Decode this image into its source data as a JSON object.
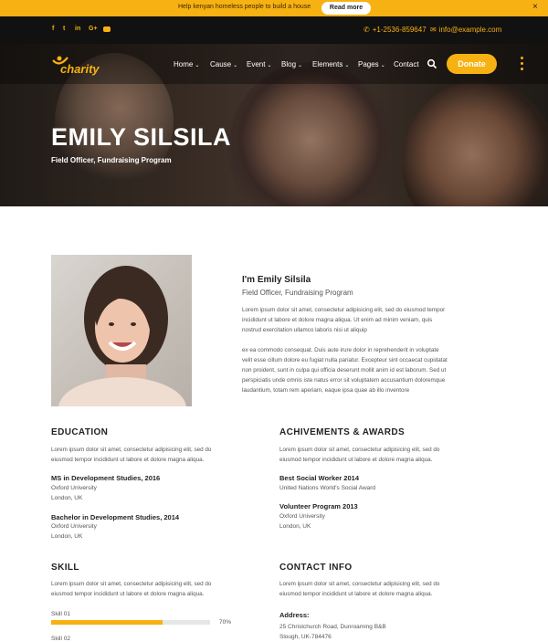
{
  "announcement": {
    "text": "Help kenyan homeless people to build a house",
    "button": "Read more",
    "close": "×"
  },
  "social": [
    "f",
    "t",
    "in",
    "G+",
    "yt"
  ],
  "contact": {
    "phone": "+1-2536-859647",
    "email": "info@example.com"
  },
  "brand": {
    "name": "charity"
  },
  "nav": {
    "items": [
      {
        "label": "Home",
        "dropdown": true
      },
      {
        "label": "Cause",
        "dropdown": true
      },
      {
        "label": "Event",
        "dropdown": true
      },
      {
        "label": "Blog",
        "dropdown": true
      },
      {
        "label": "Elements",
        "dropdown": true
      },
      {
        "label": "Pages",
        "dropdown": true
      },
      {
        "label": "Contact",
        "dropdown": false
      }
    ],
    "donate": "Donate"
  },
  "hero": {
    "title": "EMILY SILSILA",
    "subtitle": "Field Officer, Fundraising Program"
  },
  "profile": {
    "heading": "I'm Emily Silsila",
    "role": "Field Officer, Fundraising Program",
    "para1": [
      "Lorem ipsum dolor sit amet, consectetur adipisicing elit, sed do eiusmod tempor",
      "incididunt ut labore et dolore magna aliqua. Ut enim ad minim veniam, quis",
      "nostrud exercitation ullamco laboris nisi ut aliquip"
    ],
    "para2": [
      "ex ea commodo consequat. Duis aute irure dolor in reprehenderit in voluptate",
      "velit esse cillum dolore eu fugiat nulla pariatur. Excepteur sint occaecat cupidatat",
      "non proident, sunt in culpa qui officia deserunt mollit anim id est laborum. Sed ut",
      "perspiciatis unde omnis iste natus error sit voluptatem accusantium doloremque",
      "laudantium, totam rem aperiam, eaque ipsa quae ab illo inventore"
    ]
  },
  "education": {
    "title": "EDUCATION",
    "intro": [
      "Lorem ipsum dolor sit amet, consectetur adipisicing elit, sed do",
      "eiusmod tempor incididunt ut labore et dolore magna aliqua."
    ],
    "items": [
      {
        "title": "MS in Development Studies, 2016",
        "lines": [
          "Oxford University",
          "London, UK"
        ]
      },
      {
        "title": "Bachelor in Development Studies, 2014",
        "lines": [
          "Oxford University",
          "London, UK"
        ]
      }
    ]
  },
  "achievements": {
    "title": "ACHIVEMENTS & AWARDS",
    "intro": [
      "Lorem ipsum dolor sit amet, consectetur adipisicing elit, sed do",
      "eiusmod tempor incididunt ut labore et dolore magna aliqua."
    ],
    "items": [
      {
        "title": "Best Social Worker 2014",
        "lines": [
          "United Nations World's Social Award"
        ]
      },
      {
        "title": "Volunteer Program 2013",
        "lines": [
          "Oxford University",
          "London, UK"
        ]
      }
    ]
  },
  "skill": {
    "title": "SKILL",
    "intro": [
      "Lorem ipsum dolor sit amet, consectetur adipisicing elit, sed do",
      "eiusmod tempor incididunt ut labore et dolore magna aliqua."
    ],
    "items": [
      {
        "label": "Skill 01",
        "percent": 70,
        "percent_label": "70%"
      },
      {
        "label": "Skill 02"
      }
    ]
  },
  "contact_info": {
    "title": "CONTACT INFO",
    "intro": [
      "Lorem ipsum dolor sit amet, consectetur adipisicing elit, sed do",
      "eiusmod tempor incididunt ut labore et dolore magna aliqua."
    ],
    "address_label": "Address:",
    "address_lines": [
      "25 Christchurch Road, Dunroaming B&B",
      "Slough, UK-784476"
    ]
  },
  "colors": {
    "accent": "#f7b112",
    "dark": "#111111"
  }
}
